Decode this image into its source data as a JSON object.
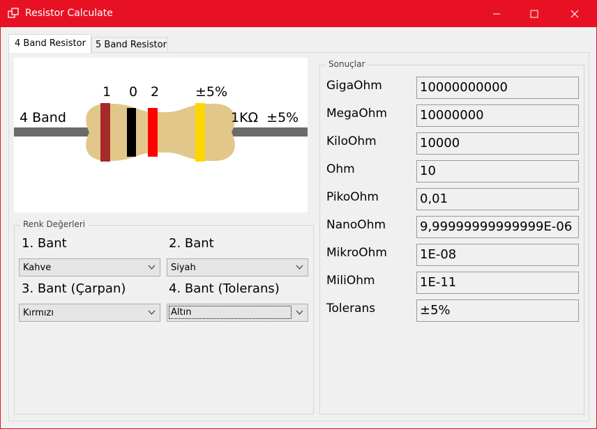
{
  "window": {
    "title": "Resistor Calculate"
  },
  "tabs": [
    {
      "label": "4 Band Resistor"
    },
    {
      "label": "5 Band Resistor"
    }
  ],
  "resistor": {
    "side_label": "4 Band",
    "value_label": "1KΩ  ±5%",
    "band_labels": [
      "1",
      "0",
      "2",
      "±5%"
    ],
    "band_colors": [
      "#a52a2a",
      "#000000",
      "#ff0000",
      "#ffd700"
    ],
    "body_color": "#e2c78a",
    "lead_color": "#6b6b6b"
  },
  "renk": {
    "title": "Renk Değerleri",
    "band1_label": "1. Bant",
    "band2_label": "2. Bant",
    "band3_label": "3. Bant (Çarpan)",
    "band4_label": "4. Bant (Tolerans)",
    "band1_value": "Kahve",
    "band2_value": "Siyah",
    "band3_value": "Kırmızı",
    "band4_value": "Altın"
  },
  "sonuclar": {
    "title": "Sonuçlar",
    "rows": [
      {
        "label": "GigaOhm",
        "value": "10000000000"
      },
      {
        "label": "MegaOhm",
        "value": "10000000"
      },
      {
        "label": "KiloOhm",
        "value": "10000"
      },
      {
        "label": "Ohm",
        "value": "10"
      },
      {
        "label": "PikoOhm",
        "value": "0,01"
      },
      {
        "label": "NanoOhm",
        "value": "9,99999999999999E-06"
      },
      {
        "label": "MikroOhm",
        "value": "1E-08"
      },
      {
        "label": "MiliOhm",
        "value": "1E-11"
      },
      {
        "label": "Tolerans",
        "value": "±5%"
      }
    ]
  }
}
